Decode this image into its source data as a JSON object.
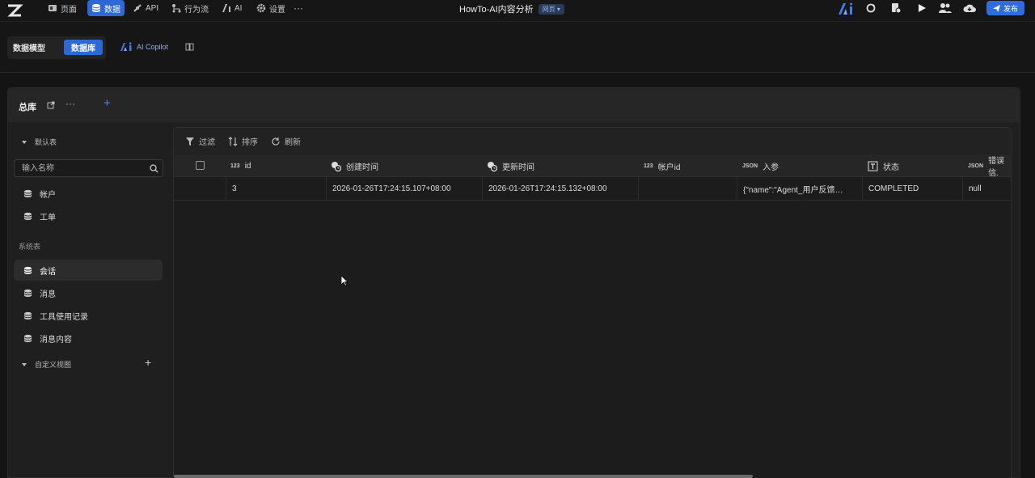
{
  "topnav": {
    "items": [
      {
        "label": "页面",
        "icon": "pages-icon"
      },
      {
        "label": "数据",
        "icon": "database-icon"
      },
      {
        "label": "API",
        "icon": "api-icon"
      },
      {
        "label": "行为流",
        "icon": "flow-icon"
      },
      {
        "label": "AI",
        "icon": "ai-icon"
      },
      {
        "label": "设置",
        "icon": "gear-icon"
      }
    ],
    "more": "···",
    "app_title": "HowTo-AI内容分析",
    "app_badge": "网页 ▾",
    "publish_label": "发布"
  },
  "subnav": {
    "seg_model": "数据模型",
    "seg_db": "数据库",
    "copilot_label": "AI Copilot"
  },
  "panel": {
    "tab_title": "总库",
    "tab_more": "···",
    "tab_add": "+"
  },
  "sidebar": {
    "section_default": "默认表",
    "search_placeholder": "输入名称",
    "default_items": [
      "帐户",
      "工单"
    ],
    "section_system": "系统表",
    "system_items": [
      "会话",
      "消息",
      "工具使用记录",
      "消息内容"
    ],
    "section_custom": "自定义视图",
    "add_label": "+"
  },
  "toolbar": {
    "filter": "过滤",
    "sort": "排序",
    "refresh": "刷新"
  },
  "table": {
    "columns": [
      {
        "type": "123",
        "label": "id"
      },
      {
        "type": "clock",
        "label": "创建时间"
      },
      {
        "type": "clock",
        "label": "更新时间"
      },
      {
        "type": "123",
        "label": "帐户id"
      },
      {
        "type": "JSON",
        "label": "入参"
      },
      {
        "type": "text",
        "label": "状态"
      },
      {
        "type": "JSON",
        "label": "错误信."
      }
    ],
    "rows": [
      [
        "3",
        "2026-01-26T17:24:15.107+08:00",
        "2026-01-26T17:24:15.132+08:00",
        "",
        "{\"name\":\"Agent_用户反馈…",
        "COMPLETED",
        "null"
      ]
    ]
  },
  "colors": {
    "accent": "#2e67d6",
    "background": "#141414"
  }
}
